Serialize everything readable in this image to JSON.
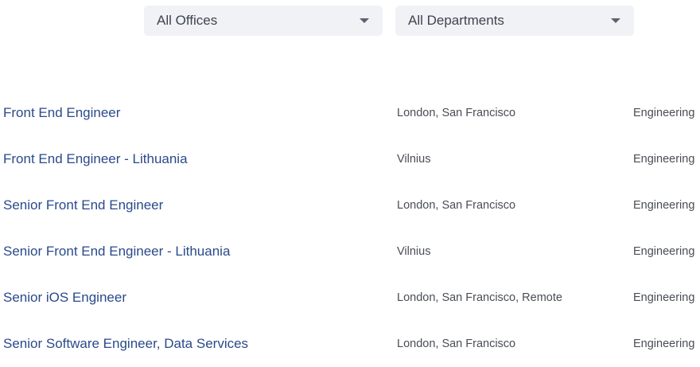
{
  "filters": {
    "offices": {
      "selected": "All Offices"
    },
    "departments": {
      "selected": "All Departments"
    }
  },
  "jobs": [
    {
      "title": "Front End Engineer",
      "location": "London, San Francisco",
      "department": "Engineering"
    },
    {
      "title": "Front End Engineer - Lithuania",
      "location": "Vilnius",
      "department": "Engineering"
    },
    {
      "title": "Senior Front End Engineer",
      "location": "London, San Francisco",
      "department": "Engineering"
    },
    {
      "title": "Senior Front End Engineer - Lithuania",
      "location": "Vilnius",
      "department": "Engineering"
    },
    {
      "title": "Senior iOS Engineer",
      "location": "London, San Francisco, Remote",
      "department": "Engineering"
    },
    {
      "title": "Senior Software Engineer, Data Services",
      "location": "London, San Francisco",
      "department": "Engineering"
    }
  ],
  "icons": {
    "dropdown": "chevron-down-icon"
  },
  "colors": {
    "link": "#2a4a8a",
    "select_bg": "#f1f2f6",
    "text": "#494d55"
  }
}
